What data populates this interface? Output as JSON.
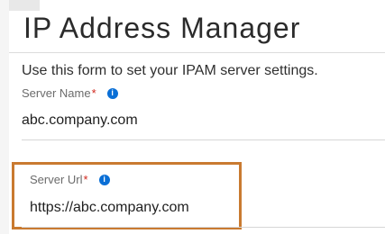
{
  "page": {
    "title": "IP Address Manager",
    "description": "Use this form to set your IPAM server settings."
  },
  "form": {
    "server_name": {
      "label": "Server Name",
      "required_mark": "*",
      "info_icon": "i",
      "value": "abc.company.com"
    },
    "server_url": {
      "label": "Server Url",
      "required_mark": "*",
      "info_icon": "i",
      "value": "https://abc.company.com"
    }
  },
  "colors": {
    "highlight": "#c97a30",
    "info_icon": "#0a6fd6",
    "required": "#d0271d"
  }
}
